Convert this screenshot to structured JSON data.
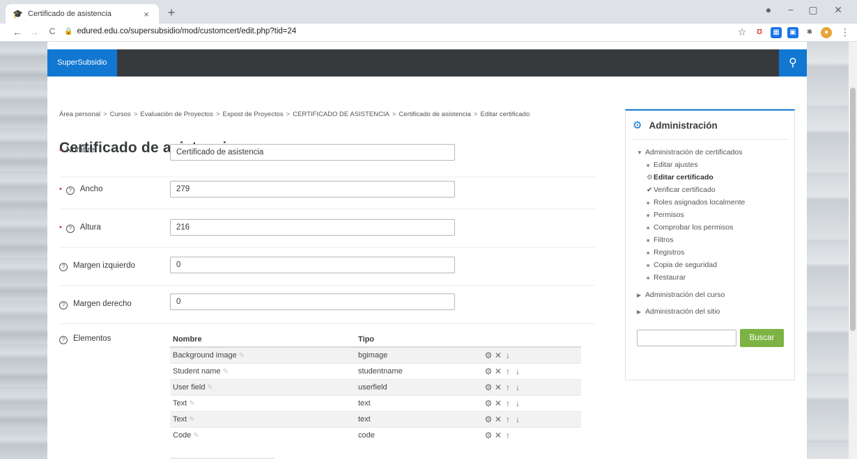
{
  "browser": {
    "tab_title": "Certificado de asistencia",
    "tab_close": "×",
    "new_tab": "+",
    "url": "edured.edu.co/supersubsidio/mod/customcert/edit.php?tid=24",
    "back": "←",
    "forward": "→",
    "reload": "C",
    "star": "☆",
    "minimize": "−",
    "maximize": "▢",
    "close": "✕",
    "menu": "⋮"
  },
  "navbar": {
    "brand": "SuperSubsidio",
    "search_icon": "🔍"
  },
  "breadcrumb": [
    "Área personal",
    "Cursos",
    "Evaluación de Proyectos",
    "Expost de Proyectos",
    "CERTIFICADO DE ASISTENCIA",
    "Certificado de asistencia",
    "Editar certificado"
  ],
  "breadcrumb_separator": ">",
  "page_title": "Certificado de asistencia",
  "form": {
    "nombre": {
      "label": "Nombre",
      "value": "Certificado de asistencia",
      "required": true
    },
    "ancho": {
      "label": "Ancho",
      "value": "279",
      "required": true
    },
    "altura": {
      "label": "Altura",
      "value": "216",
      "required": true
    },
    "margen_izquierdo": {
      "label": "Margen izquierdo",
      "value": "0"
    },
    "margen_derecho": {
      "label": "Margen derecho",
      "value": "0"
    },
    "required_mark": "•",
    "help_mark": "?"
  },
  "elements": {
    "label": "Elementos",
    "headers": {
      "nombre": "Nombre",
      "tipo": "Tipo"
    },
    "rows": [
      {
        "name": "Background image",
        "type": "bgimage"
      },
      {
        "name": "Student name",
        "type": "studentname"
      },
      {
        "name": "User field",
        "type": "userfield"
      },
      {
        "name": "Text",
        "type": "text"
      },
      {
        "name": "Text",
        "type": "text"
      },
      {
        "name": "Code",
        "type": "code"
      }
    ]
  },
  "admin": {
    "title": "Administración",
    "section_certificados": "Administración de certificados",
    "items": [
      "Editar ajustes",
      "Editar certificado",
      "Verificar certificado",
      "Roles asignados localmente",
      "Permisos",
      "Comprobar los permisos",
      "Filtros",
      "Registros",
      "Copia de seguridad",
      "Restaurar"
    ],
    "section_curso": "Administración del curso",
    "section_sitio": "Administración del sitio",
    "search_button": "Buscar"
  },
  "colors": {
    "brand_blue": "#1177d1",
    "navbar_dark": "#373a3c",
    "button_green": "#7cb342",
    "required_red": "#c9302c"
  }
}
